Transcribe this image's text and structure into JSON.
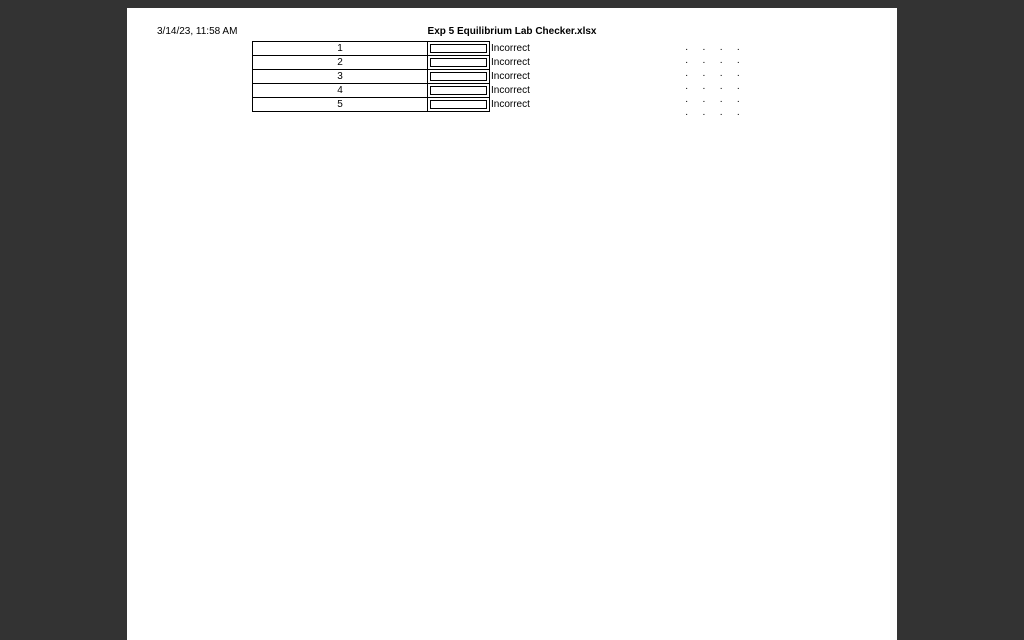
{
  "header": {
    "timestamp": "3/14/23, 11:58 AM",
    "title": "Exp 5 Equilibrium Lab Checker.xlsx"
  },
  "rows": [
    {
      "index": "1",
      "status": "Incorrect"
    },
    {
      "index": "2",
      "status": "Incorrect"
    },
    {
      "index": "3",
      "status": "Incorrect"
    },
    {
      "index": "4",
      "status": "Incorrect"
    },
    {
      "index": "5",
      "status": "Incorrect"
    }
  ],
  "dot_rows": 6,
  "dot_pattern": "·     ·     ·     ·"
}
